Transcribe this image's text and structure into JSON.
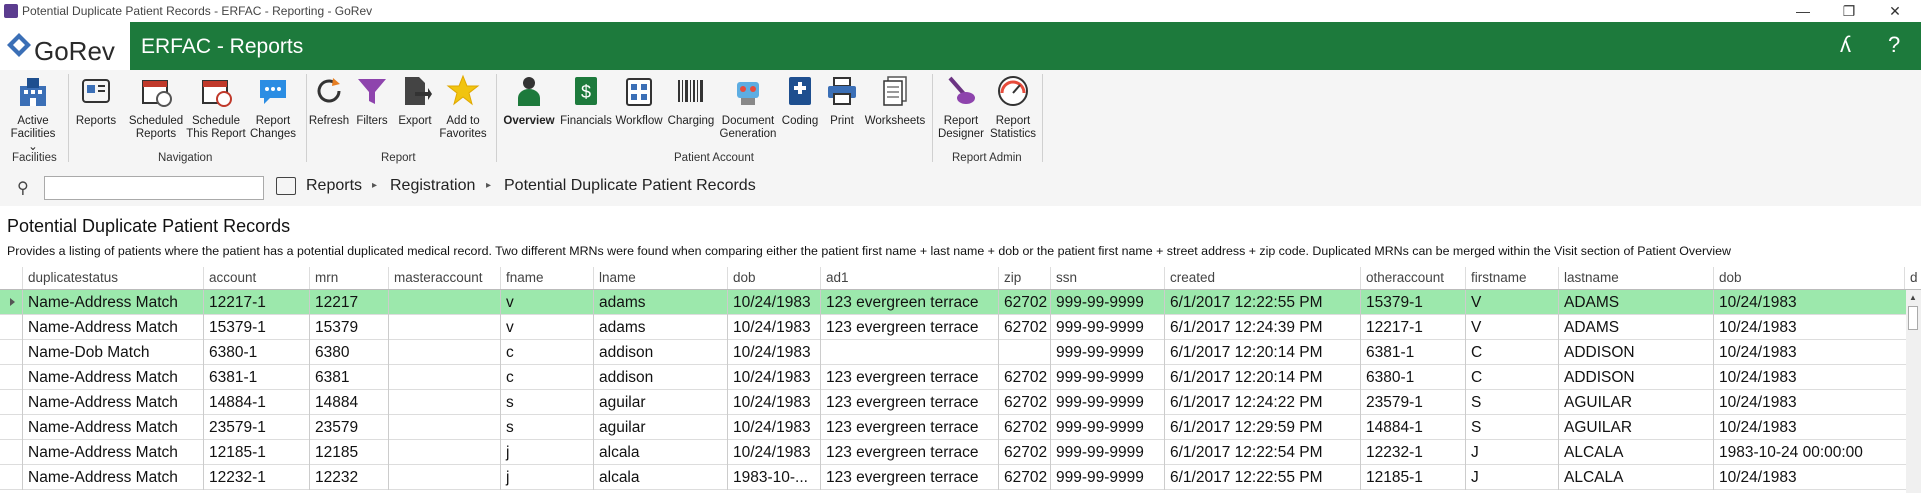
{
  "window": {
    "title": "Potential Duplicate Patient Records - ERFAC - Reporting - GoRev",
    "minimize": "—",
    "restore": "❐",
    "close": "✕"
  },
  "header": {
    "logo_text": "GoRev",
    "title": "ERFAC - Reports",
    "user_icon": "ʎ",
    "help_icon": "?"
  },
  "ribbon": {
    "buttons": {
      "active_facilities": "Active Facilities ⌄",
      "reports": "Reports",
      "scheduled_reports": "Scheduled Reports",
      "schedule_this_report": "Schedule This Report",
      "report_changes": "Report Changes",
      "refresh": "Refresh",
      "filters": "Filters",
      "export": "Export",
      "add_to_favorites": "Add to Favorites",
      "overview": "Overview",
      "financials": "Financials",
      "workflow": "Workflow",
      "charging": "Charging",
      "document_generation": "Document Generation",
      "coding": "Coding",
      "print": "Print",
      "worksheets": "Worksheets",
      "report_designer": "Report Designer",
      "report_statistics": "Report Statistics"
    },
    "groups": {
      "facilities": "Facilities",
      "navigation": "Navigation",
      "report": "Report",
      "patient_account": "Patient Account",
      "report_admin": "Report Admin"
    }
  },
  "navbar": {
    "search_placeholder": "",
    "breadcrumb": [
      "Reports",
      "Registration",
      "Potential Duplicate Patient Records"
    ],
    "separator": "▸"
  },
  "page": {
    "title": "Potential Duplicate Patient Records",
    "description": "Provides a listing of patients where the patient has a potential duplicated medical record.  Two different MRNs were found when comparing either the patient first name + last name + dob or the patient first name + street address + zip code.  Duplicated MRNs can be merged within the Visit section of Patient Overview"
  },
  "grid": {
    "columns": [
      "duplicatestatus",
      "account",
      "mrn",
      "masteraccount",
      "fname",
      "lname",
      "dob",
      "ad1",
      "zip",
      "ssn",
      "created",
      "otheraccount",
      "firstname",
      "lastname",
      "dob",
      "d"
    ],
    "rows": [
      [
        "Name-Address Match",
        "12217-1",
        "12217",
        "",
        "v",
        "adams",
        "10/24/1983",
        "123 evergreen terrace",
        "62702",
        "999-99-9999",
        "6/1/2017 12:22:55 PM",
        "15379-1",
        "V",
        "ADAMS",
        "10/24/1983"
      ],
      [
        "Name-Address Match",
        "15379-1",
        "15379",
        "",
        "v",
        "adams",
        "10/24/1983",
        "123 evergreen terrace",
        "62702",
        "999-99-9999",
        "6/1/2017 12:24:39 PM",
        "12217-1",
        "V",
        "ADAMS",
        "10/24/1983"
      ],
      [
        "Name-Dob Match",
        "6380-1",
        "6380",
        "",
        "c",
        "addison",
        "10/24/1983",
        "",
        "",
        "999-99-9999",
        "6/1/2017 12:20:14 PM",
        "6381-1",
        "C",
        "ADDISON",
        "10/24/1983"
      ],
      [
        "Name-Address Match",
        "6381-1",
        "6381",
        "",
        "c",
        "addison",
        "10/24/1983",
        "123 evergreen terrace",
        "62702",
        "999-99-9999",
        "6/1/2017 12:20:14 PM",
        "6380-1",
        "C",
        "ADDISON",
        "10/24/1983"
      ],
      [
        "Name-Address Match",
        "14884-1",
        "14884",
        "",
        "s",
        "aguilar",
        "10/24/1983",
        "123 evergreen terrace",
        "62702",
        "999-99-9999",
        "6/1/2017 12:24:22 PM",
        "23579-1",
        "S",
        "AGUILAR",
        "10/24/1983"
      ],
      [
        "Name-Address Match",
        "23579-1",
        "23579",
        "",
        "s",
        "aguilar",
        "10/24/1983",
        "123 evergreen terrace",
        "62702",
        "999-99-9999",
        "6/1/2017 12:29:59 PM",
        "14884-1",
        "S",
        "AGUILAR",
        "10/24/1983"
      ],
      [
        "Name-Address Match",
        "12185-1",
        "12185",
        "",
        "j",
        "alcala",
        "10/24/1983",
        "123 evergreen terrace",
        "62702",
        "999-99-9999",
        "6/1/2017 12:22:54 PM",
        "12232-1",
        "J",
        "ALCALA",
        "1983-10-24 00:00:00"
      ],
      [
        "Name-Address Match",
        "12232-1",
        "12232",
        "",
        "j",
        "alcala",
        "1983-10-...",
        "123 evergreen terrace",
        "62702",
        "999-99-9999",
        "6/1/2017 12:22:55 PM",
        "12185-1",
        "J",
        "ALCALA",
        "10/24/1983"
      ]
    ]
  },
  "colors": {
    "header_green": "#1d7a3c",
    "selected_row": "#9ce8ac"
  }
}
